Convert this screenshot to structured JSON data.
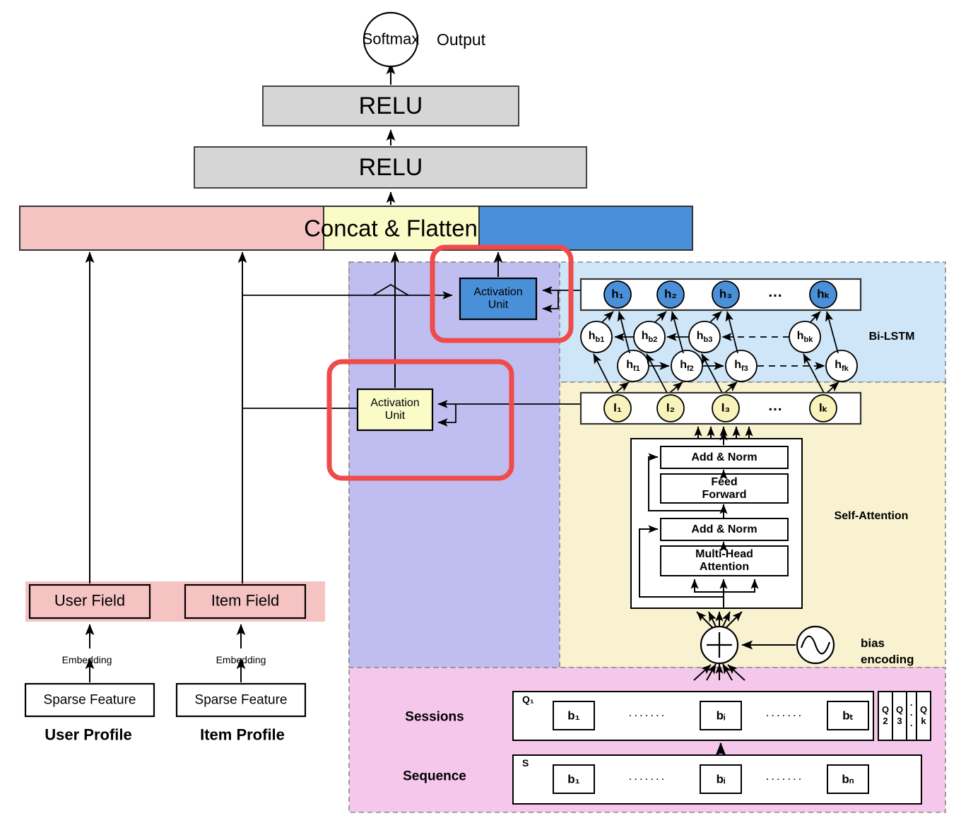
{
  "diagram": {
    "title": "Deep recommendation model with Bi-LSTM, Self-Attention and activation units",
    "output": {
      "softmax_label": "Softmax",
      "output_label": "Output"
    },
    "mlp": {
      "relu_top_label": "RELU",
      "relu_bottom_label": "RELU"
    },
    "concat": {
      "label": "Concat & Flatten",
      "segment_colors": {
        "user_item": "#f6c3c3",
        "middle": "#fbfbc8",
        "right": "#4a90d9"
      }
    },
    "activation_units": {
      "upper_label": "Activation\nUnit",
      "lower_label": "Activation\nUnit",
      "upper_fill": "#4a90d9",
      "lower_fill": "#fbfbc8",
      "highlight_color": "#ef4b4b"
    },
    "left_branch": {
      "user_field_label": "User Field",
      "item_field_label": "Item Field",
      "user_embedding_label": "Embedding",
      "item_embedding_label": "Embedding",
      "user_sparse_label": "Sparse Feature",
      "item_sparse_label": "Sparse Feature",
      "user_profile_label": "User Profile",
      "item_profile_label": "Item Profile",
      "field_band_color": "#f6c3c3"
    },
    "regions": {
      "purple": {
        "color": "#c0bdf0"
      },
      "bilstm": {
        "label": "Bi-LSTM",
        "color": "#cfe6f8"
      },
      "self_attention": {
        "label": "Self-Attention",
        "color": "#f8f2d0"
      },
      "sessions": {
        "color": "#f5c7ea"
      }
    },
    "bilstm": {
      "output_nodes": [
        "h₁",
        "h₂",
        "h₃",
        "hₖ"
      ],
      "output_ellipsis": "…",
      "backward_nodes": [
        "hб₁",
        "hб₂",
        "hб₃",
        "hбₖ"
      ],
      "backward_labels": [
        "hb1",
        "hb2",
        "hb3",
        "hbk"
      ],
      "forward_labels": [
        "hf1",
        "hf2",
        "hf3",
        "hfk"
      ],
      "node_fill_output": "#4a90d9",
      "node_fill_hidden": "#ffffff"
    },
    "input_vector": {
      "nodes": [
        "I₁",
        "I₂",
        "I₃",
        "Iₖ"
      ],
      "ellipsis": "…",
      "node_fill": "#f7f3bb"
    },
    "transformer": {
      "add_norm_top_label": "Add & Norm",
      "feed_forward_label": "Feed\nForward",
      "add_norm_bottom_label": "Add & Norm",
      "multi_head_label": "Multi-Head\nAttention"
    },
    "bias": {
      "plus_symbol": "+",
      "label": "bias\nencoding",
      "label_line1": "bias",
      "label_line2": "encoding"
    },
    "sessions_row": {
      "row_label": "Sessions",
      "group_label": "Q₁",
      "blocks": [
        "b₁",
        "bᵢ",
        "bₜ"
      ],
      "dots": "·······",
      "tabs": [
        "Q\n2",
        "Q\n3",
        "⋮",
        "Q\nk"
      ],
      "tab_q2_top": "Q",
      "tab_q2_bot": "2",
      "tab_q3_top": "Q",
      "tab_q3_bot": "3",
      "tab_dots": "·\n·\n·",
      "tab_qk_top": "Q",
      "tab_qk_bot": "k"
    },
    "sequence_row": {
      "row_label": "Sequence",
      "group_label": "S",
      "blocks": [
        "b₁",
        "bᵢ",
        "bₙ"
      ],
      "dots": "·······"
    }
  }
}
